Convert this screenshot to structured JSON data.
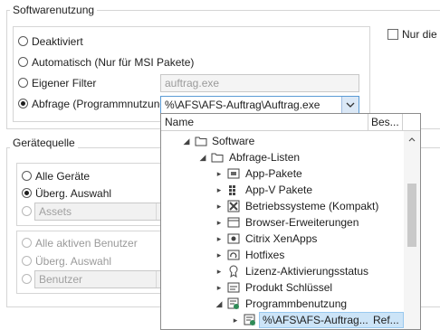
{
  "software_group": {
    "title": "Softwarenutzung",
    "options": [
      {
        "label": "Deaktiviert",
        "checked": false
      },
      {
        "label": "Automatisch (Nur für MSI Pakete)",
        "checked": false
      },
      {
        "label": "Eigener Filter",
        "checked": false
      },
      {
        "label": "Abfrage (Programmnutzung)",
        "checked": true
      }
    ],
    "filter_value": "auftrag.exe",
    "query_value": "%\\AFS\\AFS-Auftrag\\Auftrag.exe",
    "only_checkbox_label": "Nur die le"
  },
  "device_group": {
    "title": "Gerätequelle",
    "options": [
      {
        "label": "Alle Geräte",
        "checked": false
      },
      {
        "label": "Überg. Auswahl",
        "checked": true
      }
    ],
    "assets_combo": "Assets",
    "user_options": [
      {
        "label": "Alle aktiven Benutzer"
      },
      {
        "label": "Überg. Auswahl"
      }
    ],
    "user_combo": "Benutzer"
  },
  "dropdown": {
    "col_name": "Name",
    "col_desc": "Bes...",
    "tree": [
      {
        "label": "Software",
        "icon": "folder-icon",
        "expander": "open"
      },
      {
        "label": "Abfrage-Listen",
        "icon": "folder-icon",
        "expander": "open"
      },
      {
        "label": "App-Pakete",
        "icon": "app-package-icon",
        "expander": "closed"
      },
      {
        "label": "App-V Pakete",
        "icon": "appv-grid-icon",
        "expander": "closed"
      },
      {
        "label": "Betriebssysteme (Kompakt)",
        "icon": "os-icon",
        "expander": "closed"
      },
      {
        "label": "Browser-Erweiterungen",
        "icon": "browser-icon",
        "expander": "closed"
      },
      {
        "label": "Citrix XenApps",
        "icon": "citrix-icon",
        "expander": "closed"
      },
      {
        "label": "Hotfixes",
        "icon": "hotfix-icon",
        "expander": "closed"
      },
      {
        "label": "Lizenz-Aktivierungsstatus",
        "icon": "license-icon",
        "expander": "closed"
      },
      {
        "label": "Produkt Schlüssel",
        "icon": "key-icon",
        "expander": "closed"
      },
      {
        "label": "Programmbenutzung",
        "icon": "program-usage-icon",
        "expander": "open"
      },
      {
        "label": "%\\AFS\\AFS-Auftrag...",
        "desc": "Ref...",
        "icon": "program-usage-icon",
        "expander": "closed",
        "selected": true
      }
    ]
  }
}
